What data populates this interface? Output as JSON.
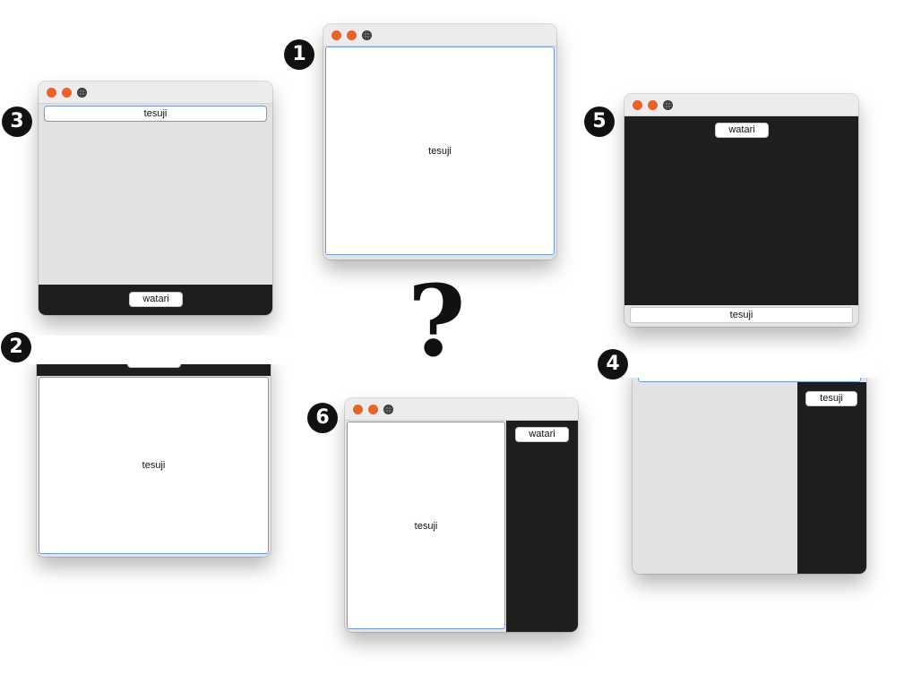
{
  "labels": {
    "tesuji": "tesuji",
    "watari": "watari"
  },
  "badges": {
    "b1": "1",
    "b2": "2",
    "b3": "3",
    "b4": "4",
    "b5": "5",
    "b6": "6"
  },
  "question": "?",
  "colors": {
    "traffic": "#e8632a",
    "dark_panel": "#1e1e1e",
    "focus_border": "#6e9ad6"
  }
}
